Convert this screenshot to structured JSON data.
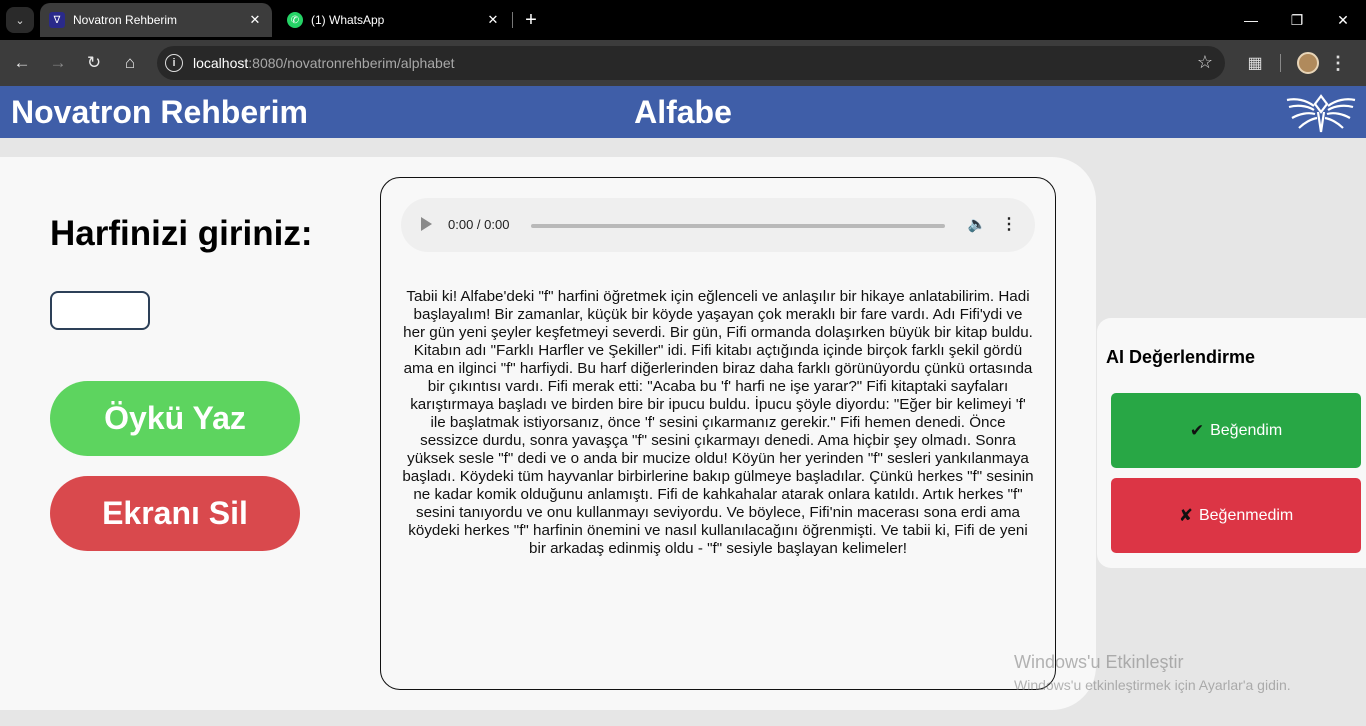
{
  "browser": {
    "tabs": [
      {
        "title": "Novatron Rehberim",
        "active": true
      },
      {
        "title": "(1) WhatsApp",
        "active": false
      }
    ],
    "url_host": "localhost",
    "url_rest": ":8080/novatronrehberim/alphabet",
    "icons": [
      "tab-search-icon",
      "back-icon",
      "forward-icon",
      "reload-icon",
      "home-icon",
      "site-info-icon",
      "bookmark-star-icon",
      "extensions-icon",
      "profile-avatar",
      "menu-icon",
      "minimize-icon",
      "restore-icon",
      "close-icon"
    ]
  },
  "header": {
    "app_title": "Novatron Rehberim",
    "page_title": "Alfabe",
    "brand_color": "#3f5ea8"
  },
  "main": {
    "prompt_label": "Harfinizi giriniz:",
    "letter_input_value": "",
    "write_button": "Öykü Yaz",
    "clear_button": "Ekranı Sil",
    "audio_time": "0:00 / 0:00",
    "story": "Tabii ki! Alfabe'deki \"f\" harfini öğretmek için eğlenceli ve anlaşılır bir hikaye anlatabilirim. Hadi başlayalım! Bir zamanlar, küçük bir köyde yaşayan çok meraklı bir fare vardı. Adı Fifi'ydi ve her gün yeni şeyler keşfetmeyi severdi. Bir gün, Fifi ormanda dolaşırken büyük bir kitap buldu. Kitabın adı \"Farklı Harfler ve Şekiller\" idi. Fifi kitabı açtığında içinde birçok farklı şekil gördü ama en ilginci \"f\" harfiydi. Bu harf diğerlerinden biraz daha farklı görünüyordu çünkü ortasında bir çıkıntısı vardı. Fifi merak etti: \"Acaba bu 'f' harfi ne işe yarar?\" Fifi kitaptaki sayfaları karıştırmaya başladı ve birden bire bir ipucu buldu. İpucu şöyle diyordu: \"Eğer bir kelimeyi 'f' ile başlatmak istiyorsanız, önce 'f' sesini çıkarmanız gerekir.\" Fifi hemen denedi. Önce sessizce durdu, sonra yavaşça \"f\" sesini çıkarmayı denedi. Ama hiçbir şey olmadı. Sonra yüksek sesle \"f\" dedi ve o anda bir mucize oldu! Köyün her yerinden \"f\" sesleri yankılanmaya başladı. Köydeki tüm hayvanlar birbirlerine bakıp gülmeye başladılar. Çünkü herkes \"f\" sesinin ne kadar komik olduğunu anlamıştı. Fifi de kahkahalar atarak onlara katıldı. Artık herkes \"f\" sesini tanıyordu ve onu kullanmayı seviyordu. Ve böylece, Fifi'nin macerası sona erdi ama köydeki herkes \"f\" harfinin önemini ve nasıl kullanılacağını öğrenmişti. Ve tabii ki, Fifi de yeni bir arkadaş edinmiş oldu - \"f\" sesiyle başlayan kelimeler!"
  },
  "rating": {
    "title": "AI Değerlendirme",
    "like_label": "Beğendim",
    "dislike_label": "Beğenmedim",
    "like_color": "#28a745",
    "dislike_color": "#dc3545"
  },
  "watermark": {
    "title": "Windows'u Etkinleştir",
    "subtitle": "Windows'u etkinleştirmek için Ayarlar'a gidin."
  }
}
